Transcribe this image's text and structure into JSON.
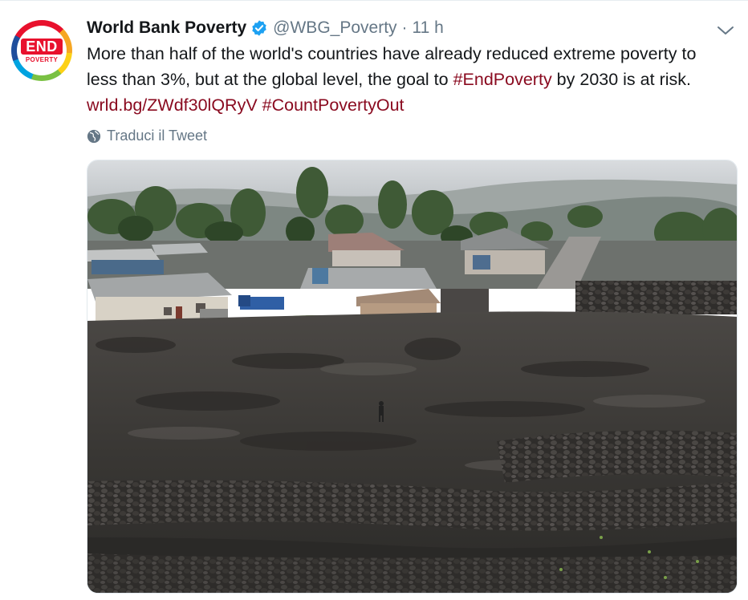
{
  "tweet": {
    "author": {
      "display_name": "World Bank Poverty",
      "handle": "@WBG_Poverty",
      "verified": true,
      "avatar_text_top": "END",
      "avatar_text_bottom": "POVERTY"
    },
    "separator": "·",
    "time": "11 h",
    "text": {
      "line1": "More than half of the world's countries have already reduced extreme poverty to",
      "line2_a": "less than 3%, but at the global level, the goal to ",
      "line2_hashtag": "#EndPoverty",
      "line2_b": " by 2030 is at risk.",
      "link": "wrld.bg/ZWdf30lQRyV",
      "hashtag2": "#CountPovertyOut"
    },
    "translate_label": "Traduci il Tweet",
    "media": {
      "icon": "photo"
    }
  },
  "colors": {
    "link": "#8a0b20",
    "muted": "#657786",
    "verified": "#1da1f2"
  }
}
